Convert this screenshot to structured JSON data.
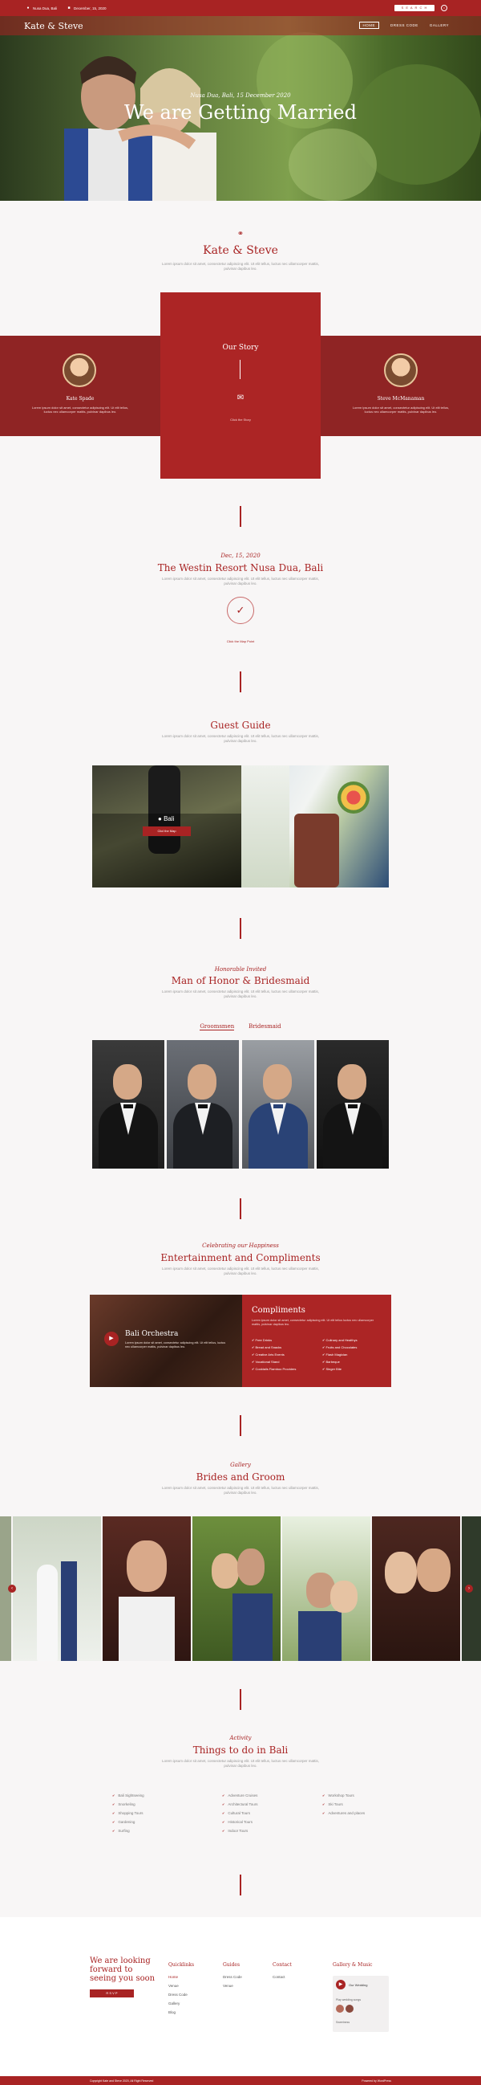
{
  "topbar": {
    "location": "Nusa Dua, Bali",
    "date": "December, 15, 2020"
  },
  "hero": {
    "logo": "Kate & Steve",
    "nav": [
      "HOME",
      "DRESS CODE",
      "GALLERY"
    ],
    "subtitle": "Nusa Dua, Bali, 15 December 2020",
    "title": "We are Getting Married"
  },
  "intro": {
    "title": "Kate & Steve",
    "desc": "Lorem ipsum dolor sit amet, consectetur adipiscing elit. Ut elit tellus, luctus nec ullamcorper mattis, pulvinar dapibus leo."
  },
  "story": {
    "label": "Our Story",
    "link": "Click the Story",
    "bride": {
      "name": "Kate Spade",
      "desc": "Lorem ipsum dolor sit amet, consectetur adipiscing elit. Ut elit tellus, luctus nec ullamcorper mattis, pulvinar dapibus leo."
    },
    "groom": {
      "name": "Steve McManaman",
      "desc": "Lorem ipsum dolor sit amet, consectetur adipiscing elit. Ut elit tellus, luctus nec ullamcorper mattis, pulvinar dapibus leo."
    }
  },
  "venue": {
    "date": "Dec, 15, 2020",
    "title": "The Westin Resort Nusa Dua, Bali",
    "desc": "Lorem ipsum dolor sit amet, consectetur adipiscing elit. Ut elit tellus, luctus nec ullamcorper mattis, pulvinar dapibus leo.",
    "link": "Click the Map Point"
  },
  "guide": {
    "title": "Guest Guide",
    "desc": "Lorem ipsum dolor sit amet, consectetur adipiscing elit. Ut elit tellus, luctus nec ullamcorper mattis, pulvinar dapibus leo.",
    "place": "Bali",
    "button": "Clicl the Map"
  },
  "honor": {
    "kicker": "Honorable Invited",
    "title": "Man of Honor & Bridesmaid",
    "desc": "Lorem ipsum dolor sit amet, consectetur adipiscing elit. Ut elit tellus, luctus nec ullamcorper mattis, pulvinar dapibus leo.",
    "tabs": [
      "Groomsmen",
      "Bridesmaid"
    ]
  },
  "entertain": {
    "kicker": "Celebrating our Happiness",
    "title": "Entertainment and Compliments",
    "desc": "Lorem ipsum dolor sit amet, consectetur adipiscing elit. Ut elit tellus, luctus nec ullamcorper mattis, pulvinar dapibus leo.",
    "band": "Bali Orchestra",
    "band_desc": "Lorem ipsum dolor sit amet, consectetur adipiscing elit. Ut elit tellus, luctus nec ullamcorper mattis, pulvinar dapibus leo.",
    "comp_title": "Compliments",
    "comp_desc": "Lorem ipsum dolor sit amet, consectetur adipiscing elit. Ut elit tellus luctus nec ullamcorper mattis, pulvinar dapibus leo.",
    "left_list": [
      "Free Drinks",
      "Bread and Snacks",
      "Creative Arts Events",
      "Vocational Stand",
      "Cocktails Flamboo Providers"
    ],
    "right_list": [
      "Culinary and Healthys",
      "Fruits and Chocolates",
      "Flash Magician",
      "Barbeque",
      "Singer Bite"
    ]
  },
  "gallery": {
    "kicker": "Gallery",
    "title": "Brides and Groom",
    "desc": "Lorem ipsum dolor sit amet, consectetur adipiscing elit. Ut elit tellus, luctus nec ullamcorper mattis, pulvinar dapibus leo."
  },
  "activity": {
    "kicker": "Activity",
    "title": "Things to do in Bali",
    "desc": "Lorem ipsum dolor sit amet, consectetur adipiscing elit. Ut elit tellus, luctus nec ullamcorper mattis, pulvinar dapibus leo.",
    "col1": [
      "Bali Sightseeing",
      "Snorkeling",
      "Shopping Tours",
      "Gardening",
      "Surfing"
    ],
    "col2": [
      "Adventure Cruises",
      "Architectural Tours",
      "Cultural Tours",
      "Historical Tours",
      "Indoor Tours"
    ],
    "col3": [
      "Workshop Tours",
      "Ski Tours",
      "Adventures and places"
    ]
  },
  "footer": {
    "cta": "We are looking forward to seeing you soon",
    "cta_button": "R S V P",
    "quicklinks": {
      "title": "Quicklinks",
      "items": [
        "Home",
        "Venue",
        "Dress Code",
        "Gallery",
        "Blog"
      ]
    },
    "guides": {
      "title": "Guides",
      "items": [
        "Dress Code",
        "Venue"
      ]
    },
    "contact": {
      "title": "Contact",
      "items": [
        "Contact"
      ]
    },
    "music": {
      "title": "Gallery & Music",
      "player": "Our Wedding",
      "playlist": "Play wedding songs",
      "track": "Sweetness"
    },
    "copyright": "Copyright Kate and Steve 2020, All Right Reserved",
    "credit": "Powered by WordPress"
  }
}
